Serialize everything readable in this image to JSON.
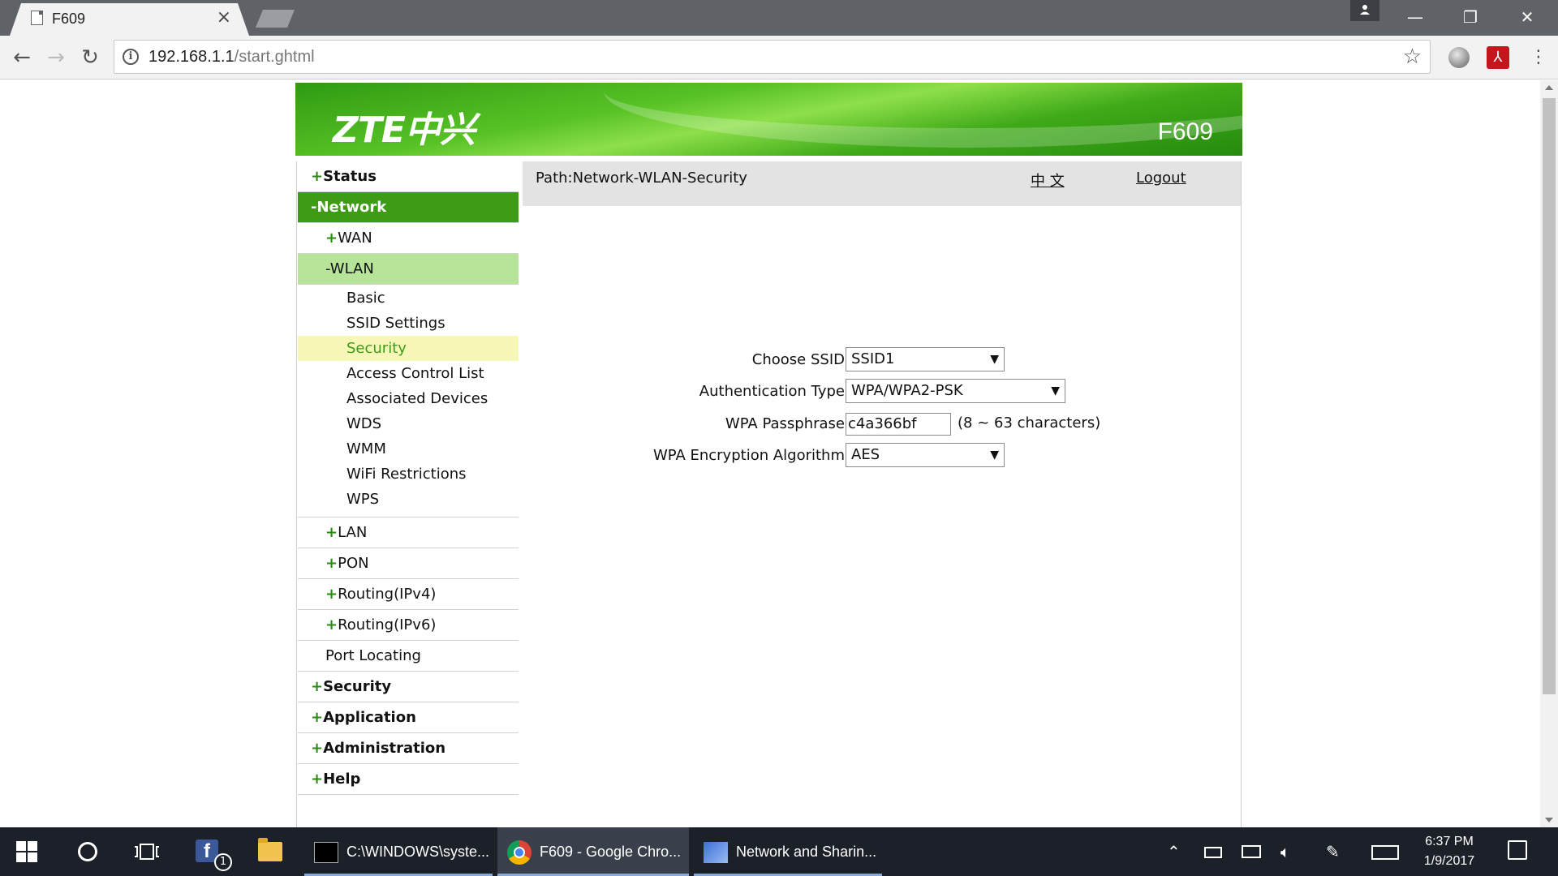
{
  "browser": {
    "tab_title": "F609",
    "tab_close": "×",
    "url_host": "192.168.1.1",
    "url_path": "/start.ghtml",
    "back": "←",
    "forward": "→",
    "reload": "↻",
    "star": "☆",
    "menu": "⋮",
    "minimize": "—",
    "restore": "❐",
    "close": "✕"
  },
  "banner": {
    "logo": "ZTE中兴",
    "model": "F609"
  },
  "nav": {
    "status": "Status",
    "network": "Network",
    "wan": "WAN",
    "wlan": "WLAN",
    "wlan_items": [
      "Basic",
      "SSID Settings",
      "Security",
      "Access Control List",
      "Associated Devices",
      "WDS",
      "WMM",
      "WiFi Restrictions",
      "WPS"
    ],
    "lan": "LAN",
    "pon": "PON",
    "routing_ipv4": "Routing(IPv4)",
    "routing_ipv6": "Routing(IPv6)",
    "port_locating": "Port Locating",
    "security": "Security",
    "application": "Application",
    "administration": "Administration",
    "help": "Help",
    "plus": "+",
    "minus": "-"
  },
  "header": {
    "path": "Path:Network-WLAN-Security",
    "lang": "中 文",
    "logout": "Logout"
  },
  "form": {
    "choose_ssid_label": "Choose SSID",
    "choose_ssid_value": "SSID1",
    "auth_type_label": "Authentication Type",
    "auth_type_value": "WPA/WPA2-PSK",
    "passphrase_label": "WPA Passphrase",
    "passphrase_value": "c4a366bf",
    "passphrase_hint": "(8 ~ 63 characters)",
    "encryption_label": "WPA Encryption Algorithm",
    "encryption_value": "AES",
    "caret": "▼"
  },
  "taskbar": {
    "fb_badge": "1",
    "apps": [
      {
        "label": "C:\\WINDOWS\\syste..."
      },
      {
        "label": "F609 - Google Chro..."
      },
      {
        "label": "Network and Sharin..."
      }
    ],
    "time": "6:37 PM",
    "date": "1/9/2017",
    "tray_chevron": "⌃"
  }
}
